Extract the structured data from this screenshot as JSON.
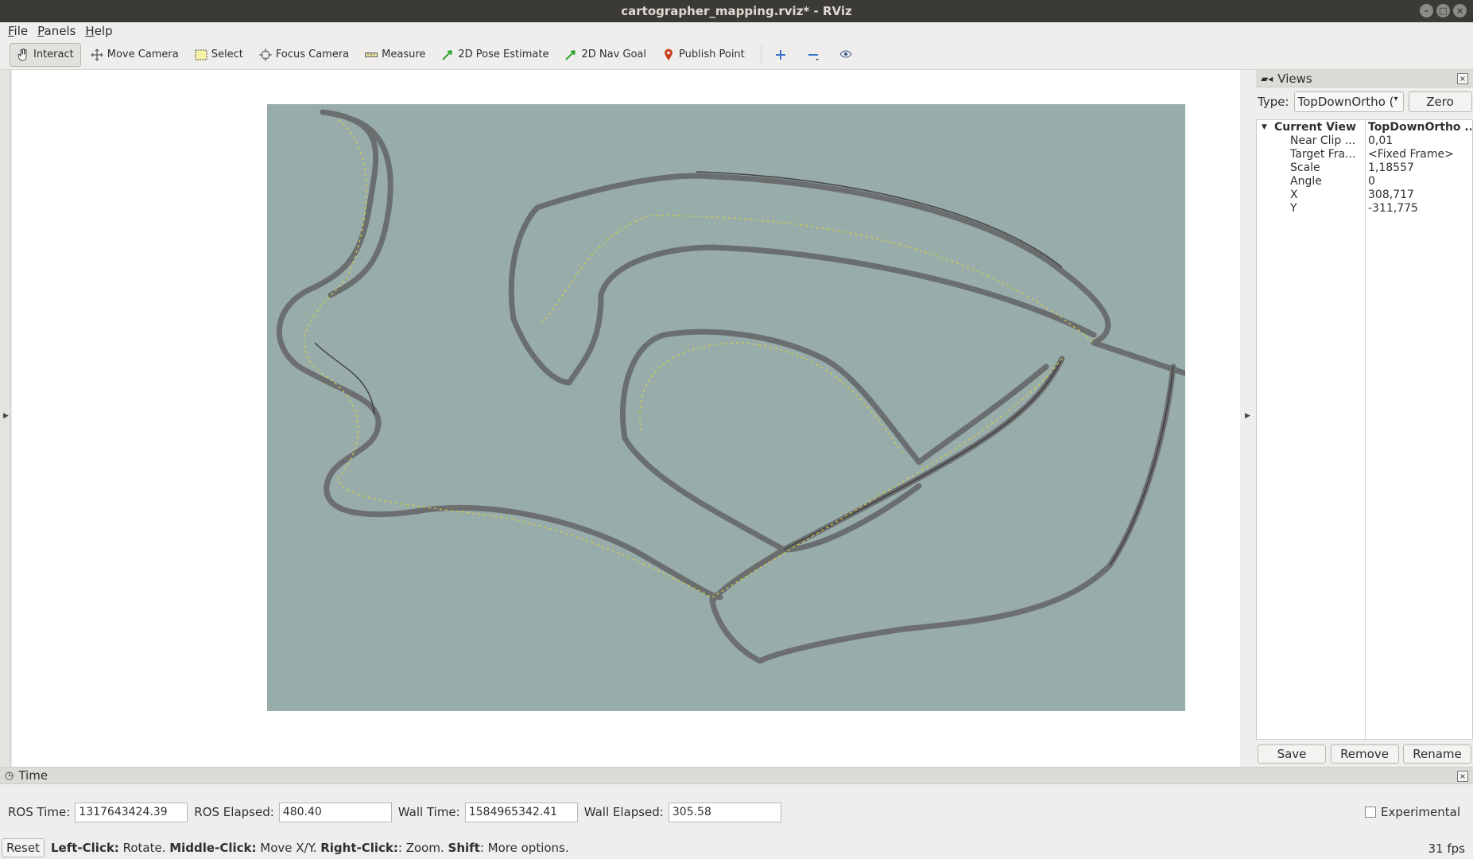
{
  "window": {
    "title": "cartographer_mapping.rviz* - RViz"
  },
  "menu": [
    {
      "first": "F",
      "rest": "ile"
    },
    {
      "first": "P",
      "rest": "anels"
    },
    {
      "first": "H",
      "rest": "elp"
    }
  ],
  "toolbar": {
    "interact": "Interact",
    "move_camera": "Move Camera",
    "select": "Select",
    "focus_camera": "Focus Camera",
    "measure": "Measure",
    "pose_estimate": "2D Pose Estimate",
    "nav_goal": "2D Nav Goal",
    "publish_point": "Publish Point"
  },
  "views": {
    "title": "Views",
    "type_label": "Type:",
    "type_value": "TopDownOrtho (",
    "zero_button": "Zero",
    "current_view": {
      "key": "Current View",
      "value": "TopDownOrtho ..."
    },
    "props": [
      {
        "key": "Near Clip ...",
        "value": "0,01"
      },
      {
        "key": "Target Fra...",
        "value": "<Fixed Frame>"
      },
      {
        "key": "Scale",
        "value": "1,18557"
      },
      {
        "key": "Angle",
        "value": "0"
      },
      {
        "key": "X",
        "value": "308,717"
      },
      {
        "key": "Y",
        "value": "-311,775"
      }
    ],
    "save": "Save",
    "remove": "Remove",
    "rename": "Rename"
  },
  "time": {
    "title": "Time",
    "ros_time_label": "ROS Time:",
    "ros_time": "1317643424.39",
    "ros_elapsed_label": "ROS Elapsed:",
    "ros_elapsed": "480.40",
    "wall_time_label": "Wall Time:",
    "wall_time": "1584965342.41",
    "wall_elapsed_label": "Wall Elapsed:",
    "wall_elapsed": "305.58",
    "experimental": "Experimental"
  },
  "status": {
    "reset": "Reset",
    "left_click": "Left-Click:",
    "left_action": " Rotate. ",
    "middle_click": "Middle-Click:",
    "middle_action": " Move X/Y. ",
    "right_click": "Right-Click:",
    "right_action": ": Zoom. ",
    "shift": "Shift",
    "shift_action": ": More options.",
    "fps": "31 fps"
  },
  "colors": {
    "map_background": "#98acaa",
    "map_walls": "#5d5a5c",
    "trajectory": "#d8d23a"
  }
}
